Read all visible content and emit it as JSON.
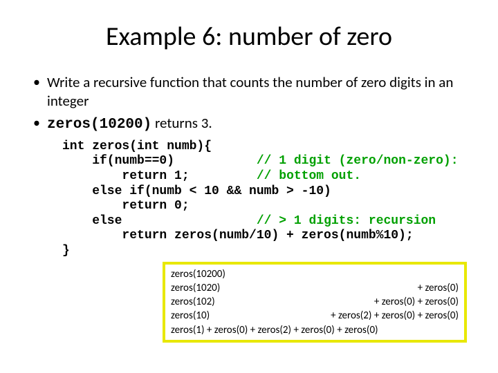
{
  "title": "Example 6: number of zero",
  "bullets": [
    "Write a recursive function that counts the number of zero digits in an integer",
    "zeros(10200) returns 3."
  ],
  "bullet2_mono": "zeros(10200)",
  "bullet2_tail": " returns 3.",
  "code": {
    "l1": "int zeros(int numb){",
    "l2": "    if(numb==0)           ",
    "l2c": "// 1 digit (zero/non-zero):",
    "l3": "        return 1;         ",
    "l3c": "// bottom out.",
    "l4": "    else if(numb < 10 && numb > -10)",
    "l5": "        return 0;",
    "l6": "    else                  ",
    "l6c": "// > 1 digits: recursion",
    "l7": "        return zeros(numb/10) + zeros(numb%10);",
    "l8": "}"
  },
  "trace": [
    {
      "left": "zeros(10200)",
      "right": ""
    },
    {
      "left": "zeros(1020)",
      "right": "+ zeros(0)"
    },
    {
      "left": "zeros(102)",
      "right": "+ zeros(0) + zeros(0)"
    },
    {
      "left": "zeros(10)",
      "right": "+ zeros(2) + zeros(0) + zeros(0)"
    },
    {
      "left": "zeros(1) + zeros(0) + zeros(2) + zeros(0) + zeros(0)",
      "right": ""
    }
  ]
}
